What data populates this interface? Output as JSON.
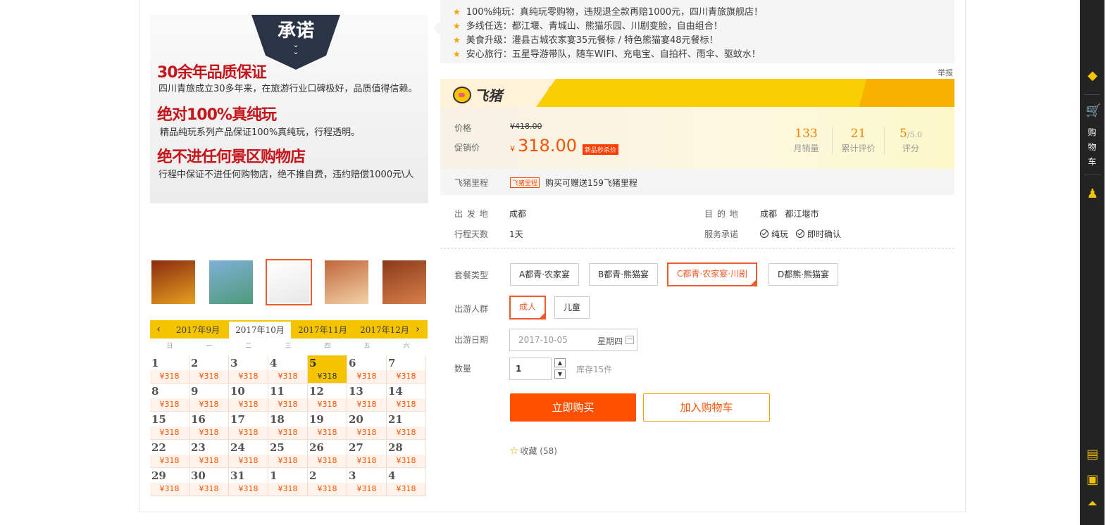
{
  "promise": {
    "ribbon": "承诺",
    "items": [
      {
        "title": "30余年品质保证",
        "desc": "四川青旅成立30多年来，在旅游行业口碑极好，品质值得信赖。"
      },
      {
        "title": "绝对100%真纯玩",
        "desc": "精品纯玩系列产品保证100%真纯玩，行程透明。"
      },
      {
        "title": "绝不进任何景区购物店",
        "desc": "行程中保证不进任何购物店，绝不推自费，违约赔偿1000元\\人"
      }
    ]
  },
  "thumbnails": [
    {
      "name": "thumb-promo-1",
      "colors": [
        "#8a2a10",
        "#e6a020"
      ]
    },
    {
      "name": "thumb-river",
      "colors": [
        "#7fb0d8",
        "#4f9a7a"
      ]
    },
    {
      "name": "thumb-promise",
      "colors": [
        "#ffffff",
        "#e8e8e8"
      ]
    },
    {
      "name": "thumb-food",
      "colors": [
        "#c0663a",
        "#f3d2a8"
      ]
    },
    {
      "name": "thumb-old-town",
      "colors": [
        "#8a3a1a",
        "#d9804a"
      ]
    }
  ],
  "calendar": {
    "months": [
      "2017年9月",
      "2017年10月",
      "2017年11月",
      "2017年12月"
    ],
    "active_month": "2017年10月",
    "weekdays": [
      "日",
      "一",
      "二",
      "三",
      "四",
      "五",
      "六"
    ],
    "price_label": "¥318",
    "selected_day": "5",
    "weeks": [
      [
        "1",
        "2",
        "3",
        "4",
        "5",
        "6",
        "7"
      ],
      [
        "8",
        "9",
        "10",
        "11",
        "12",
        "13",
        "14"
      ],
      [
        "15",
        "16",
        "17",
        "18",
        "19",
        "20",
        "21"
      ],
      [
        "22",
        "23",
        "24",
        "25",
        "26",
        "27",
        "28"
      ],
      [
        "29",
        "30",
        "31",
        "1",
        "2",
        "3",
        "4"
      ]
    ]
  },
  "highlights": [
    "100%纯玩：真纯玩零购物，违规退全款再赔1000元，四川青旅旗舰店！",
    "多线任选：都江堰、青城山、熊猫乐园、川剧变脸，自由组合！",
    "美食升级：灌县古城农家宴35元餐标 / 特色熊猫宴48元餐标！",
    "安心旅行：五星导游带队，随车WIFI、充电宝、自拍杆、雨伞、驱蚊水！"
  ],
  "report": "举报",
  "brand": {
    "logo_text": "飞猪"
  },
  "price": {
    "label_price": "价格",
    "old_price": "¥418.00",
    "label_promo": "促销价",
    "currency": "¥",
    "promo_price": "318.00",
    "sale_tag": "新品秒杀价",
    "stats": [
      {
        "value": "133",
        "suffix": "",
        "label": "月销量"
      },
      {
        "value": "21",
        "suffix": "",
        "label": "累计评价"
      },
      {
        "value": "5",
        "suffix": "/5.0",
        "label": "评分"
      }
    ]
  },
  "miles": {
    "label": "飞猪里程",
    "tag": "飞猪里程",
    "text": "购买可赠送159飞猪里程"
  },
  "info": {
    "from_label": "出 发 地",
    "from": "成都",
    "dest_label": "目 的 地",
    "dest": "成都   都江堰市",
    "days_label": "行程天数",
    "days": "1天",
    "service_label": "服务承诺",
    "service": [
      "纯玩",
      "即时确认"
    ]
  },
  "package": {
    "label": "套餐类型",
    "options": [
      "A都青·农家宴",
      "B都青·熊猫宴",
      "C都青·农家宴·川剧",
      "D都熊·熊猫宴"
    ],
    "selected": "C都青·农家宴·川剧"
  },
  "group": {
    "label": "出游人群",
    "options": [
      "成人",
      "儿童"
    ],
    "selected": "成人"
  },
  "date": {
    "label": "出游日期",
    "value": "2017-10-05",
    "weekday": "星期四"
  },
  "quantity": {
    "label": "数量",
    "value": "1",
    "up": "▲",
    "down": "▼",
    "stock": "库存15件"
  },
  "actions": {
    "buy": "立即购买",
    "cart": "加入购物车",
    "fav": "收藏",
    "fav_count": "(58)"
  },
  "sidebar": {
    "cart_chars": [
      "购",
      "物",
      "车"
    ]
  },
  "colors": {
    "accent": "#ff5000",
    "yellow": "#f5c400",
    "dark": "#232323"
  }
}
